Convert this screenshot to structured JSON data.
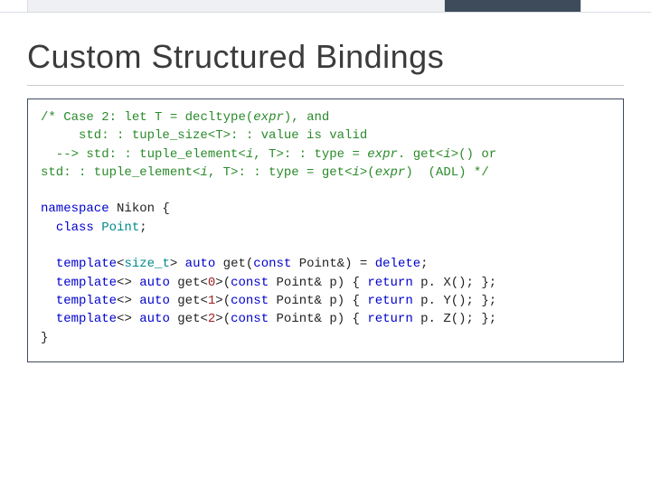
{
  "header": {
    "title": "Custom Structured Bindings"
  },
  "code": {
    "c_open": "/* ",
    "c_case": "Case 2: let T = decltype(",
    "c_expr1": "expr",
    "c_and": "), and",
    "c_l2a": "     std: : tuple_size<T>: : value is valid",
    "c_l3a": "  --> std: : tuple_element<",
    "c_i": "i",
    "c_l3b": ", T>: : type = ",
    "c_l3c": ". get<",
    "c_l3d": ">() or",
    "c_l4a": "std: : tuple_element<",
    "c_l4b": ", T>: : type = get<",
    "c_l4c": ">(",
    "c_l4d": ")  (ADL) */",
    "ns": "namespace",
    "nsname": " Nikon {",
    "cls": "class",
    "ptdecl": " Point",
    "semi": ";",
    "tpl": "template",
    "lt": "<",
    "gt": ">",
    "sizet": "size_t",
    "auto": "auto",
    "sp": " ",
    "get": " get(",
    "getn": " get<",
    "const": "const",
    "amp": " Point&) = ",
    "ampp": " Point& p) { ",
    "del": "delete",
    "ret": "return",
    "n0": "0",
    "n1": "1",
    "n2": "2",
    "px": " p. X(); };",
    "py": " p. Y(); };",
    "pz": " p. Z(); };",
    "close": "}"
  }
}
